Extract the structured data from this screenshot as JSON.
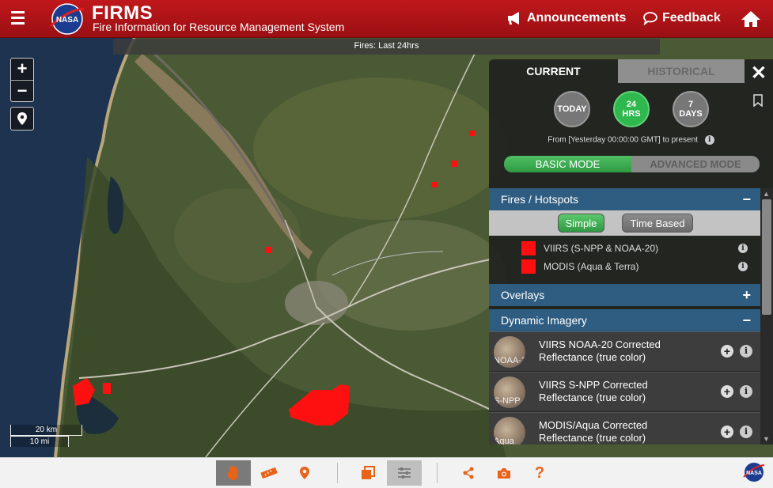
{
  "header": {
    "brand_title": "FIRMS",
    "brand_subtitle": "Fire Information for Resource Management System",
    "logo_text": "NASA",
    "nav": {
      "announcements": "Announcements",
      "feedback": "Feedback"
    }
  },
  "map": {
    "fires_label": "Fires: Last 24hrs",
    "zoom_in": "+",
    "zoom_out": "−",
    "scale_km": "20 km",
    "scale_mi": "10 mi"
  },
  "panel": {
    "tabs": {
      "current": "CURRENT",
      "historical": "HISTORICAL"
    },
    "close": "✕",
    "time_buttons": [
      {
        "line1": "TODAY",
        "line2": ""
      },
      {
        "line1": "24",
        "line2": "HRS"
      },
      {
        "line1": "7",
        "line2": "DAYS"
      }
    ],
    "from_text": "From [Yesterday 00:00:00 GMT] to present",
    "mode": {
      "basic": "BASIC MODE",
      "advanced": "ADVANCED MODE"
    },
    "sections": {
      "fires": {
        "title": "Fires / Hotspots",
        "sign": "−"
      },
      "overlays": {
        "title": "Overlays",
        "sign": "+"
      },
      "dynamic": {
        "title": "Dynamic Imagery",
        "sign": "−"
      }
    },
    "fire_modes": {
      "simple": "Simple",
      "time_based": "Time Based"
    },
    "fire_layers": [
      {
        "label": "VIIRS (S-NPP & NOAA-20)",
        "color": "#ff1010"
      },
      {
        "label": "MODIS (Aqua & Terra)",
        "color": "#ff1010"
      }
    ],
    "imagery": [
      {
        "thumb": "NOAA-20",
        "line1": "VIIRS NOAA-20 Corrected",
        "line2": "Reflectance (true color)"
      },
      {
        "thumb": "S-NPP",
        "line1": "VIIRS S-NPP Corrected",
        "line2": "Reflectance (true color)"
      },
      {
        "thumb": "Aqua",
        "line1": "MODIS/Aqua Corrected",
        "line2": "Reflectance (true color)"
      }
    ],
    "info_symbol": "i",
    "plus_symbol": "+"
  },
  "toolbar": {
    "accent_color": "#e8631a",
    "tools": [
      "pan-tool",
      "measure-tool",
      "location-tool",
      "layers-tool",
      "settings-tool",
      "share-tool",
      "camera-tool",
      "help-tool"
    ],
    "help_label": "?"
  }
}
